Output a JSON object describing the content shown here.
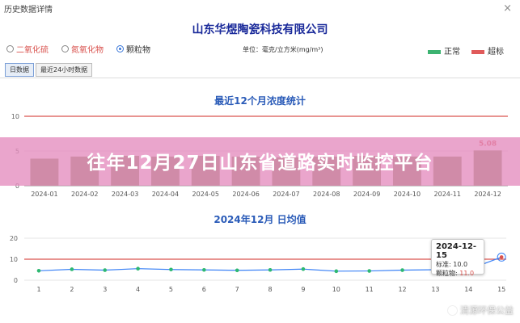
{
  "window": {
    "title": "历史数据详情",
    "close": "×"
  },
  "company": "山东华煜陶瓷科技有限公司",
  "pollutants": [
    {
      "label": "二氧化硫",
      "selected": false
    },
    {
      "label": "氮氧化物",
      "selected": false
    },
    {
      "label": "颗粒物",
      "selected": true
    }
  ],
  "unit": "单位：毫克/立方米(mg/m³)",
  "legend": {
    "normal": "正常",
    "over": "超标",
    "normal_color": "#3cb371",
    "over_color": "#e05a5a"
  },
  "tabs": [
    {
      "label": "日数据",
      "active": true
    },
    {
      "label": "最近24小时数据",
      "active": false
    }
  ],
  "colors": {
    "accent": "#2a5bb8",
    "bar": "#8a8a5a",
    "line": "#3b82f6",
    "limit": "#d9534f"
  },
  "banner": "往年12月27日山东省道路实时监控平台",
  "tooltip": {
    "date": "2024-12-15",
    "limit_label": "标准:",
    "limit_value": "10.0",
    "value_label": "颗粒物:",
    "value": "11.0"
  },
  "watermark": "清源环保公益",
  "chart_data": [
    {
      "type": "bar",
      "title": "最近12个月浓度统计",
      "categories": [
        "2024-01",
        "2024-02",
        "2024-03",
        "2024-04",
        "2024-05",
        "2024-06",
        "2024-07",
        "2024-08",
        "2024-09",
        "2024-10",
        "2024-11",
        "2024-12"
      ],
      "values": [
        3.9,
        4.2,
        4.3,
        4.2,
        4.3,
        4.2,
        4.1,
        4.2,
        4.3,
        4.2,
        4.2,
        5.08
      ],
      "data_labels": {
        "11": "5.08"
      },
      "limit": 10,
      "ylim": [
        0,
        10
      ],
      "yticks": [
        0,
        5,
        10
      ],
      "grid": true
    },
    {
      "type": "line",
      "title": "2024年12月 日均值",
      "x": [
        1,
        2,
        3,
        4,
        5,
        6,
        7,
        8,
        9,
        10,
        11,
        12,
        13,
        14,
        15
      ],
      "values": [
        4.5,
        5.2,
        4.8,
        5.5,
        5.1,
        4.9,
        4.7,
        4.9,
        5.3,
        4.3,
        4.4,
        4.8,
        5.0,
        5.1,
        11.0
      ],
      "limit": 10,
      "ylim": [
        0,
        20
      ],
      "yticks": [
        0,
        10,
        20
      ],
      "grid": true
    }
  ]
}
